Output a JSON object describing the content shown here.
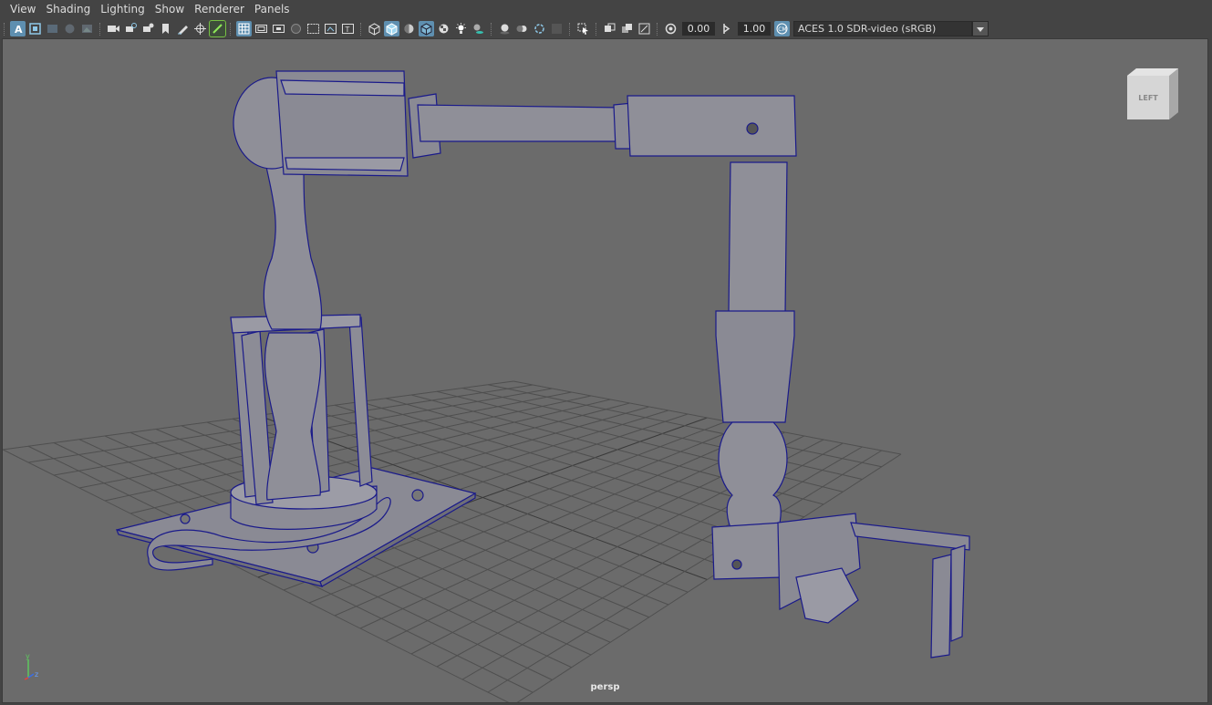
{
  "menu": {
    "items": [
      "View",
      "Shading",
      "Lighting",
      "Show",
      "Renderer",
      "Panels"
    ]
  },
  "toolbar": {
    "exposure_value": "0.00",
    "gamma_value": "1.00",
    "color_space": "ACES 1.0 SDR-video (sRGB)"
  },
  "viewport": {
    "camera_label": "persp",
    "viewcube_label": "LEFT",
    "axis": {
      "y": "y",
      "z": "z"
    }
  },
  "colors": {
    "viewport_bg": "#6b6b6b",
    "wireframe": "#1a1a8a",
    "mesh_fill": "#8f8f98",
    "grid": "#4a4a4a",
    "accent": "#5e8fb0"
  }
}
